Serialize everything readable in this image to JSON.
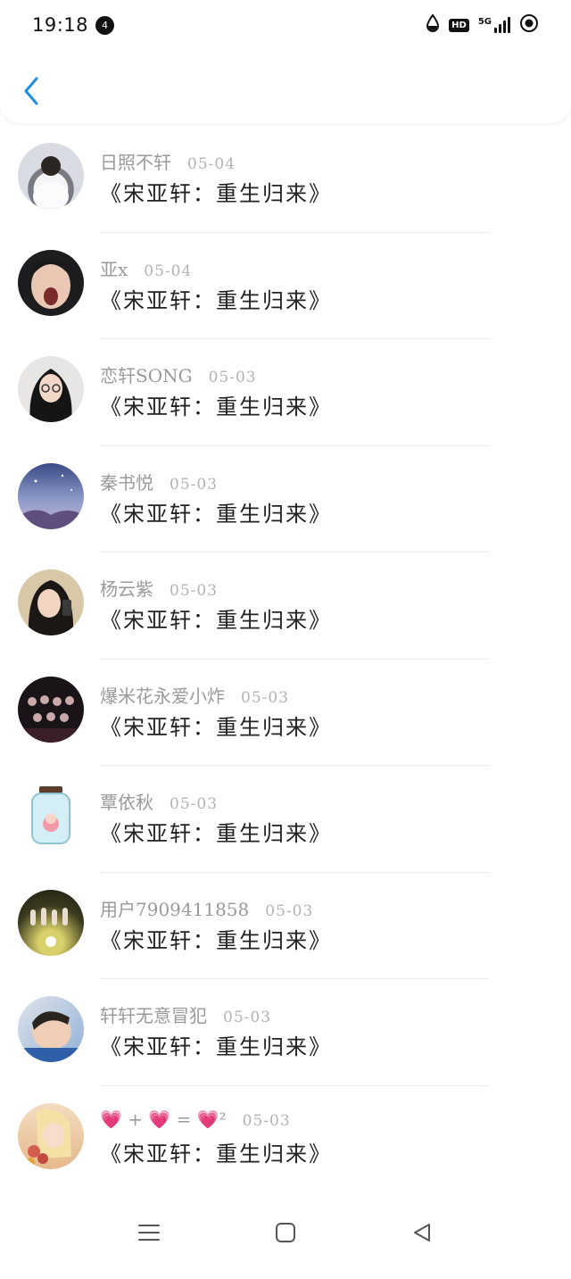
{
  "status_bar": {
    "time": "19:18",
    "notif_count": "4",
    "hd": "HD",
    "network": "5G"
  },
  "colors": {
    "accent": "#1a8fe3",
    "username": "#9a9a9a",
    "date": "#b3b3b3",
    "title": "#222222",
    "heart": "#e0457b"
  },
  "items": [
    {
      "user": "日照不轩",
      "date": "05-04",
      "title": "《宋亚轩：重生归来》"
    },
    {
      "user": "亚x",
      "date": "05-04",
      "title": "《宋亚轩：重生归来》"
    },
    {
      "user": "恋轩SONG",
      "date": "05-03",
      "title": "《宋亚轩：重生归来》"
    },
    {
      "user": "秦书悦",
      "date": "05-03",
      "title": "《宋亚轩：重生归来》"
    },
    {
      "user": "杨云紫",
      "date": "05-03",
      "title": "《宋亚轩：重生归来》"
    },
    {
      "user": "爆米花永爱小炸",
      "date": "05-03",
      "title": "《宋亚轩：重生归来》"
    },
    {
      "user": "覃依秋",
      "date": "05-03",
      "title": "《宋亚轩：重生归来》"
    },
    {
      "user": "用户7909411858",
      "date": "05-03",
      "title": "《宋亚轩：重生归来》"
    },
    {
      "user": "轩轩无意冒犯",
      "date": "05-03",
      "title": "《宋亚轩：重生归来》"
    },
    {
      "user": "💗 + 💗 = 💗²",
      "date": "05-03",
      "title": "《宋亚轩：重生归来》"
    }
  ]
}
